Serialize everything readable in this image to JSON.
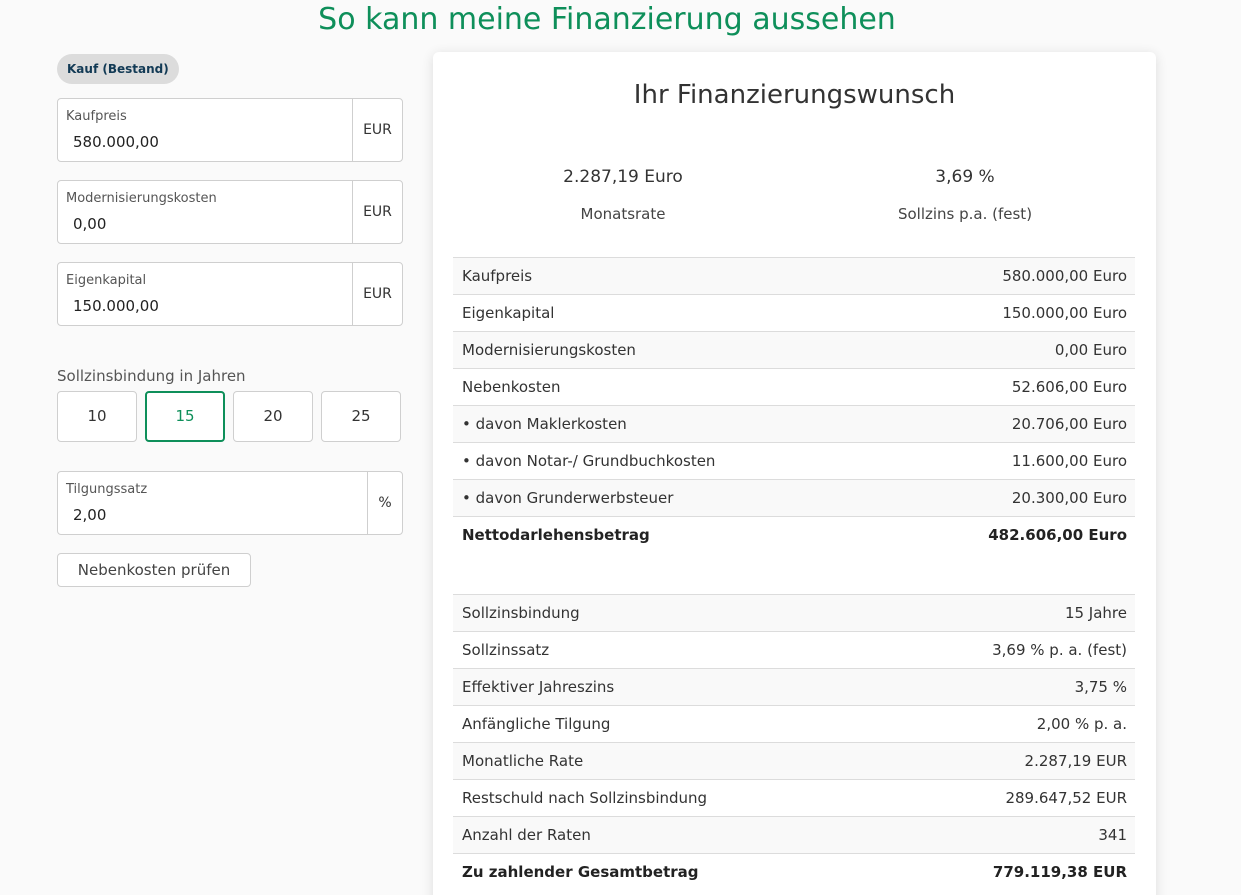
{
  "page": {
    "title": "So kann meine Finanzierung aussehen"
  },
  "form": {
    "badge": "Kauf (Bestand)",
    "fields": [
      {
        "label": "Kaufpreis",
        "value": "580.000,00",
        "unit": "EUR"
      },
      {
        "label": "Modernisierungskosten",
        "value": "0,00",
        "unit": "EUR"
      },
      {
        "label": "Eigenkapital",
        "value": "150.000,00",
        "unit": "EUR"
      }
    ],
    "sollzins_label": "Sollzinsbindung in Jahren",
    "years": [
      "10",
      "15",
      "20",
      "25"
    ],
    "selected_year": "15",
    "tilgung": {
      "label": "Tilgungssatz",
      "value": "2,00",
      "unit": "%"
    },
    "check_button": "Nebenkosten prüfen"
  },
  "summary": {
    "title": "Ihr Finanzierungswunsch",
    "monthly": {
      "value": "2.287,19 Euro",
      "label": "Monatsrate"
    },
    "rate": {
      "value": "3,69 %",
      "label": "Sollzins p.a. (fest)"
    },
    "costs": [
      {
        "label": "Kaufpreis",
        "value": "580.000,00 Euro"
      },
      {
        "label": "Eigenkapital",
        "value": "150.000,00 Euro"
      },
      {
        "label": "Modernisierungskosten",
        "value": "0,00 Euro"
      },
      {
        "label": "Nebenkosten",
        "value": "52.606,00 Euro"
      },
      {
        "label": "• davon Maklerkosten",
        "value": "20.706,00 Euro"
      },
      {
        "label": "• davon Notar-/ Grundbuchkosten",
        "value": "11.600,00 Euro"
      },
      {
        "label": "• davon Grunderwerbsteuer",
        "value": "20.300,00 Euro"
      },
      {
        "label": "Nettodarlehensbetrag",
        "value": "482.606,00 Euro",
        "bold": true
      }
    ],
    "terms": [
      {
        "label": "Sollzinsbindung",
        "value": "15 Jahre"
      },
      {
        "label": "Sollzinssatz",
        "value": "3,69 % p. a. (fest)"
      },
      {
        "label": "Effektiver Jahreszins",
        "value": "3,75 %"
      },
      {
        "label": "Anfängliche Tilgung",
        "value": "2,00 % p. a."
      },
      {
        "label": "Monatliche Rate",
        "value": "2.287,19 EUR"
      },
      {
        "label": "Restschuld nach Sollzinsbindung",
        "value": "289.647,52 EUR"
      },
      {
        "label": "Anzahl der Raten",
        "value": "341"
      },
      {
        "label": "Zu zahlender Gesamtbetrag",
        "value": "779.119,38 EUR",
        "bold": true
      }
    ]
  },
  "colors": {
    "accent": "#0e8f5a",
    "badge_bg": "#dcdcdc",
    "badge_text": "#123a55"
  }
}
